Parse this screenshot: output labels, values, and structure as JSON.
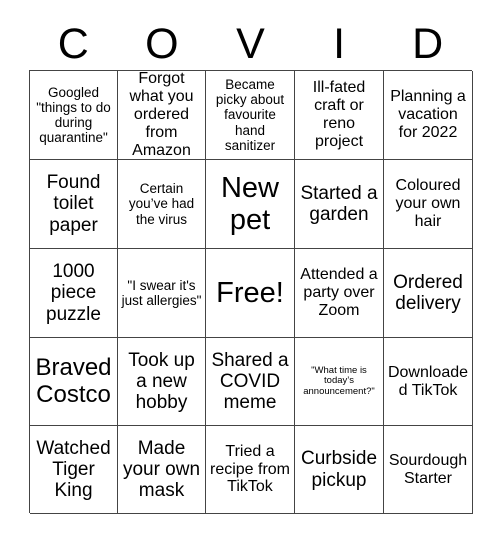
{
  "card": {
    "header_letters": [
      "C",
      "O",
      "V",
      "I",
      "D"
    ],
    "rows": [
      [
        {
          "text": "Googled \"things to do during quarantine\"",
          "size": "s"
        },
        {
          "text": "Forgot what you ordered from Amazon",
          "size": "m"
        },
        {
          "text": "Became picky about favourite hand sanitizer",
          "size": "s"
        },
        {
          "text": "Ill-fated craft or reno project",
          "size": "m"
        },
        {
          "text": "Planning a vacation for 2022",
          "size": "m"
        }
      ],
      [
        {
          "text": "Found toilet paper",
          "size": "l"
        },
        {
          "text": "Certain you’ve had the virus",
          "size": "s"
        },
        {
          "text": "New pet",
          "size": "xxl"
        },
        {
          "text": "Started a garden",
          "size": "l"
        },
        {
          "text": "Coloured your own hair",
          "size": "m"
        }
      ],
      [
        {
          "text": "1000 piece puzzle",
          "size": "l"
        },
        {
          "text": "\"I swear it's just allergies\"",
          "size": "s"
        },
        {
          "text": "Free!",
          "size": "xxl"
        },
        {
          "text": "Attended a party over Zoom",
          "size": "m"
        },
        {
          "text": "Ordered delivery",
          "size": "l"
        }
      ],
      [
        {
          "text": "Braved Costco",
          "size": "xl"
        },
        {
          "text": "Took up a new hobby",
          "size": "l"
        },
        {
          "text": "Shared a COVID meme",
          "size": "l"
        },
        {
          "text": "\"What time is today’s announcement?\"",
          "size": "xs"
        },
        {
          "text": "Downloaded TikTok",
          "size": "m"
        }
      ],
      [
        {
          "text": "Watched Tiger King",
          "size": "l"
        },
        {
          "text": "Made your own mask",
          "size": "l"
        },
        {
          "text": "Tried a recipe from TikTok",
          "size": "m"
        },
        {
          "text": "Curbside pickup",
          "size": "l"
        },
        {
          "text": "Sourdough Starter",
          "size": "m"
        }
      ]
    ]
  }
}
